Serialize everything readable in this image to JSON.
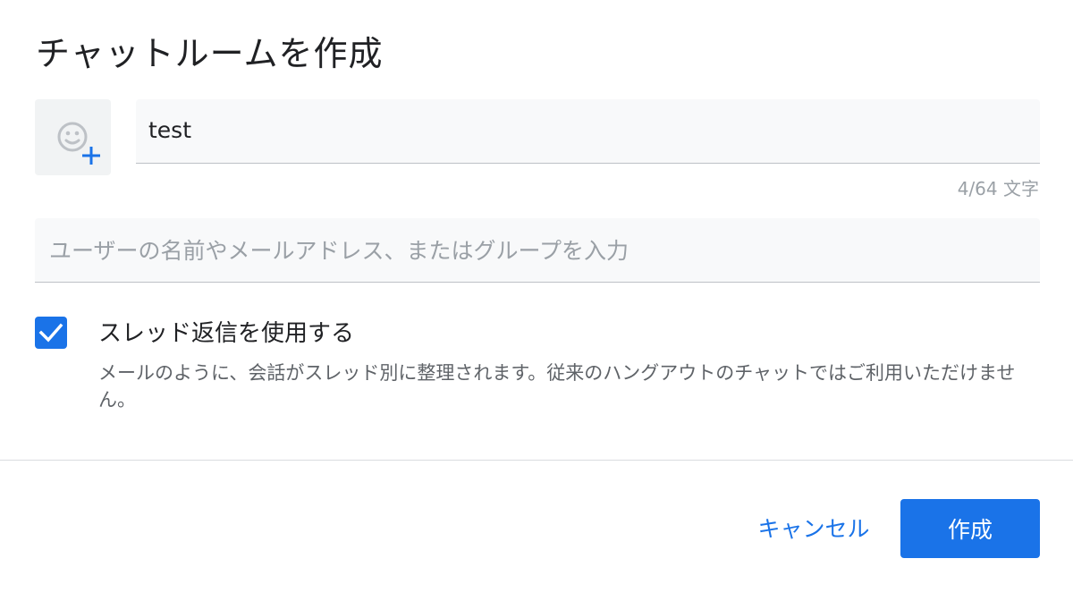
{
  "dialog": {
    "title": "チャットルームを作成"
  },
  "room_name": {
    "value": "test",
    "char_count": "4/64 文字"
  },
  "people": {
    "placeholder": "ユーザーの名前やメールアドレス、またはグループを入力",
    "value": ""
  },
  "threaded_replies": {
    "checked": true,
    "label": "スレッド返信を使用する",
    "description": "メールのように、会話がスレッド別に整理されます。従来のハングアウトのチャットではご利用いただけません。"
  },
  "actions": {
    "cancel_label": "キャンセル",
    "create_label": "作成"
  },
  "colors": {
    "accent": "#1a73e8",
    "title_text": "#202124",
    "secondary_text": "#5f6368",
    "hint_text": "#9aa0a6",
    "field_background": "#f8f9fa"
  },
  "icons": {
    "emoji_picker": "add-emoji-icon",
    "checkbox": "checkmark-icon"
  }
}
